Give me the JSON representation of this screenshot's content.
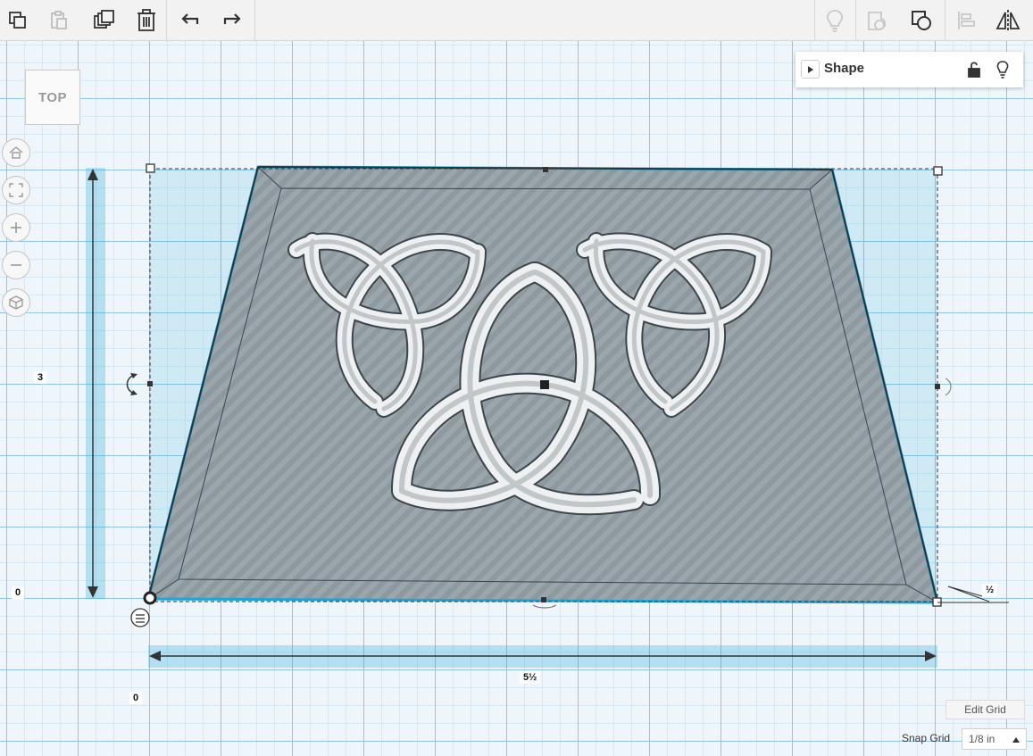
{
  "toolbar": {
    "left_tools": [
      {
        "name": "copy-icon",
        "label": "Copy"
      },
      {
        "name": "paste-icon",
        "label": "Paste"
      },
      {
        "name": "duplicate-icon",
        "label": "Duplicate"
      },
      {
        "name": "trash-icon",
        "label": "Delete"
      },
      {
        "name": "undo-icon",
        "label": "Undo"
      },
      {
        "name": "redo-icon",
        "label": "Redo"
      }
    ],
    "right_tools": [
      {
        "name": "lightbulb-icon",
        "state": "disabled"
      },
      {
        "name": "hole-shape-icon",
        "state": "disabled"
      },
      {
        "name": "group-icon",
        "state": "enabled"
      },
      {
        "name": "align-icon",
        "state": "disabled"
      },
      {
        "name": "mirror-icon",
        "state": "enabled"
      }
    ]
  },
  "viewcube": {
    "label": "TOP"
  },
  "nav_controls": [
    "home-icon",
    "fit-view-icon",
    "zoom-in-icon",
    "zoom-out-icon",
    "perspective-cube-icon"
  ],
  "shape_panel": {
    "title": "Shape",
    "lock_icon": "unlock-icon",
    "light_icon": "lightbulb-icon"
  },
  "dimensions": {
    "height": "3",
    "height_origin": "0",
    "width": "5½",
    "width_origin": "0",
    "depth": "½"
  },
  "grid": {
    "edit_label": "Edit Grid",
    "snap_label": "Snap Grid",
    "snap_value": "1/8 in"
  },
  "colors": {
    "selection": "#1ea5d8",
    "shape_fill": "#8e9aa1",
    "grid_major": "#8fc6e4",
    "grid_minor": "#d3e9f5"
  }
}
